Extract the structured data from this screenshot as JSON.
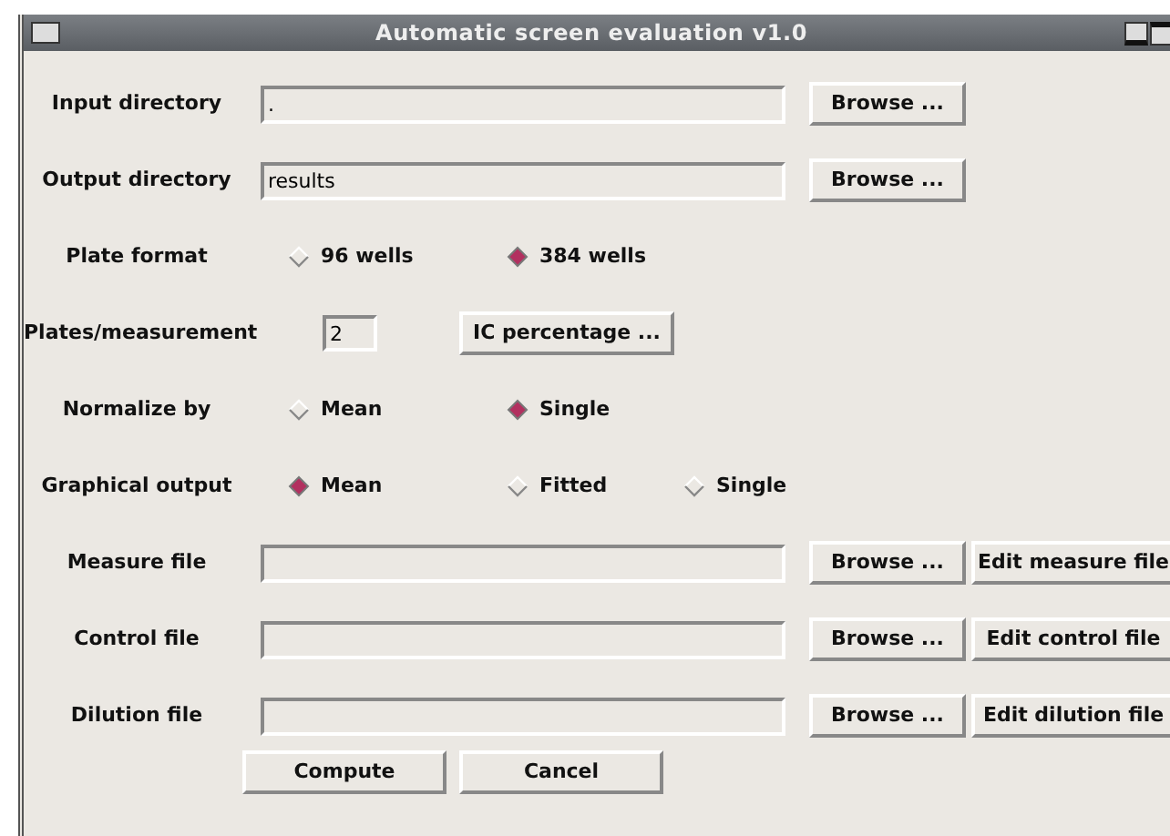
{
  "window": {
    "title": "Automatic screen evaluation v1.0"
  },
  "rows": [
    {
      "kind": "path",
      "label": "Input directory",
      "value": ".",
      "browse": "Browse ..."
    },
    {
      "kind": "path",
      "label": "Output directory",
      "value": "results",
      "browse": "Browse ..."
    },
    {
      "kind": "radio",
      "label": "Plate format",
      "options": [
        {
          "label": "96 wells",
          "selected": false
        },
        {
          "label": "384 wells",
          "selected": true
        }
      ]
    },
    {
      "kind": "number",
      "label": "Plates/measurement",
      "value": "2",
      "button": "IC percentage ..."
    },
    {
      "kind": "radio",
      "label": "Normalize by",
      "options": [
        {
          "label": "Mean",
          "selected": false
        },
        {
          "label": "Single",
          "selected": true
        }
      ]
    },
    {
      "kind": "radio",
      "label": "Graphical output",
      "options": [
        {
          "label": "Mean",
          "selected": true
        },
        {
          "label": "Fitted",
          "selected": false
        },
        {
          "label": "Single",
          "selected": false
        }
      ]
    },
    {
      "kind": "file",
      "label": "Measure file",
      "value": "",
      "browse": "Browse ...",
      "edit": "Edit measure file"
    },
    {
      "kind": "file",
      "label": "Control file",
      "value": "",
      "browse": "Browse ...",
      "edit": "Edit control file"
    },
    {
      "kind": "file",
      "label": "Dilution file",
      "value": "",
      "browse": "Browse ...",
      "edit": "Edit dilution file"
    }
  ],
  "actions": [
    "Compute",
    "Cancel"
  ]
}
